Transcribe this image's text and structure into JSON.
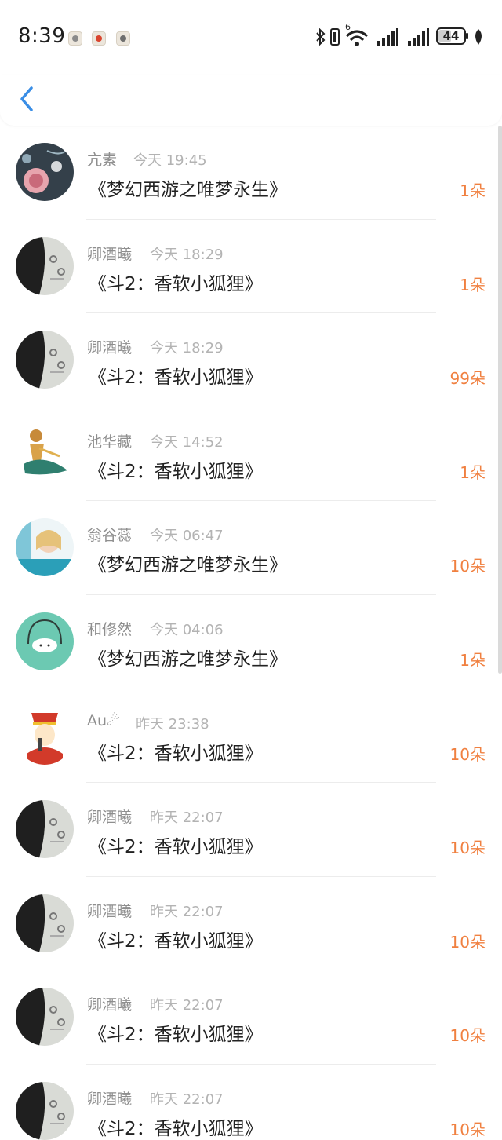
{
  "status_bar": {
    "time": "8:39",
    "battery_level": "44",
    "network_label": "6",
    "notification_icons": [
      "app-notification-icon",
      "app-notification-icon",
      "app-notification-icon"
    ]
  },
  "header": {
    "back_icon": "chevron-left-icon"
  },
  "colors": {
    "accent_blue": "#3a8ee6",
    "gift_orange": "#f08040",
    "name_gray": "#8e8e8e",
    "time_gray": "#b3b3b3"
  },
  "records": [
    {
      "name": "亢素",
      "time": "今天 19:45",
      "title": "《梦幻西游之唯梦永生》",
      "count": "1朵"
    },
    {
      "name": "卿酒曦",
      "time": "今天 18:29",
      "title": "《斗2：香软小狐狸》",
      "count": "1朵"
    },
    {
      "name": "卿酒曦",
      "time": "今天 18:29",
      "title": "《斗2：香软小狐狸》",
      "count": "99朵"
    },
    {
      "name": "池华藏",
      "time": "今天 14:52",
      "title": "《斗2：香软小狐狸》",
      "count": "1朵"
    },
    {
      "name": "翁谷蕊",
      "time": "今天 06:47",
      "title": "《梦幻西游之唯梦永生》",
      "count": "10朵"
    },
    {
      "name": "和修然",
      "time": "今天 04:06",
      "title": "《梦幻西游之唯梦永生》",
      "count": "1朵"
    },
    {
      "name": "Au☄",
      "time": "昨天 23:38",
      "title": "《斗2：香软小狐狸》",
      "count": "10朵"
    },
    {
      "name": "卿酒曦",
      "time": "昨天 22:07",
      "title": "《斗2：香软小狐狸》",
      "count": "10朵"
    },
    {
      "name": "卿酒曦",
      "time": "昨天 22:07",
      "title": "《斗2：香软小狐狸》",
      "count": "10朵"
    },
    {
      "name": "卿酒曦",
      "time": "昨天 22:07",
      "title": "《斗2：香软小狐狸》",
      "count": "10朵"
    },
    {
      "name": "卿酒曦",
      "time": "昨天 22:07",
      "title": "《斗2：香软小狐狸》",
      "count": "10朵"
    }
  ]
}
